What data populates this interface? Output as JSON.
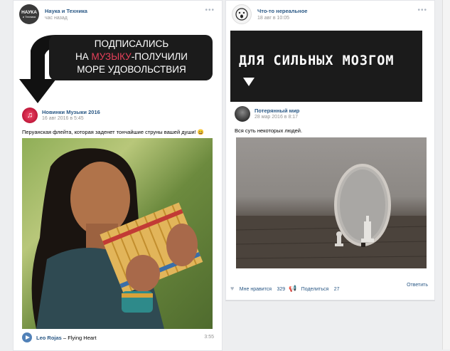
{
  "left_post": {
    "group_name": "Наука и Техника",
    "group_avatar_text_line1": "НАУКА",
    "group_avatar_text_line2": "и Техника",
    "time": "час назад",
    "banner": {
      "line1": "ПОДПИСАЛИСЬ",
      "line2_prefix": "НА ",
      "line2_highlight": "МУЗЫКУ",
      "line2_suffix": "-ПОЛУЧИЛИ",
      "line3": "МОРЕ УДОВОЛЬСТВИЯ"
    },
    "repost": {
      "author": "Новинки Музыки 2016",
      "date": "16 авг 2016 в 5:45",
      "text": "Перуанская флейта, которая заденет тончайшие струны вашей души!",
      "emoji": "😄"
    },
    "audio": {
      "artist": "Leo Rojas",
      "separator": " – ",
      "title": "Flying Heart",
      "duration": "3:55"
    }
  },
  "right_post": {
    "group_name": "Что-то нереальное",
    "time": "18 авг в 10:05",
    "banner_text": "ДЛЯ СИЛЬНЫХ МОЗГОМ",
    "repost": {
      "author": "Потерянный мир",
      "date": "28 мар 2016 в 8:17",
      "text": "Вся суть некоторых людей."
    },
    "footer": {
      "like_label": "Мне нравится",
      "like_count": "329",
      "share_label": "Поделиться",
      "share_count": "27",
      "reply_label": "Ответить"
    }
  },
  "colors": {
    "link": "#2a5885",
    "highlight": "#e8405a",
    "banner_bg": "#1b1b1b"
  }
}
